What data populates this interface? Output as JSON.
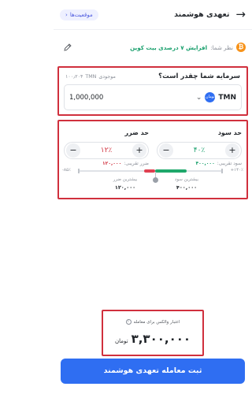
{
  "header": {
    "title": "تعهدی هوشمند",
    "positions_label": "موقعیت‌ها"
  },
  "prediction": {
    "label": "نظر شما:",
    "value": "افزایش ۷ درصدی بیت کوین"
  },
  "investment": {
    "question": "سرمایه شما چقدر است؟",
    "balance_label": "موجودی",
    "balance_unit": "TMN",
    "balance_value": "۱۰۰٫۲۰۴",
    "currency_code": "TMN",
    "currency_coin_text": "تومان",
    "amount": "1,000,000"
  },
  "take_profit": {
    "title": "حد سود",
    "percent": "۴۰٪",
    "approx_label": "سود تقریبی:",
    "approx_value": "۴۰۰,۰۰۰"
  },
  "stop_loss": {
    "title": "حد ضرر",
    "percent": "۱۲٪",
    "approx_label": "ضرر تقریبی:",
    "approx_value": "۱۲۰,۰۰۰"
  },
  "slider": {
    "left_edge": "-۸۵٪",
    "right_edge": "+۱۴۰٪",
    "max_profit_label": "بیشترین سود",
    "max_profit_value": "۴۰۰,۰۰۰",
    "max_loss_label": "بیشترین ضرر",
    "max_loss_value": "۱۲۰,۰۰۰"
  },
  "funding": {
    "label": "اعتبار والکس برای معامله",
    "value": "۳,۳۰۰,۰۰۰",
    "unit": "تومان"
  },
  "submit": {
    "label": "ثبت معامله تعهدی هوشمند"
  },
  "colors": {
    "accent": "#2f6ef2",
    "profit": "#1aa06d",
    "loss": "#d0303d",
    "highlight_border": "#d0303d"
  }
}
